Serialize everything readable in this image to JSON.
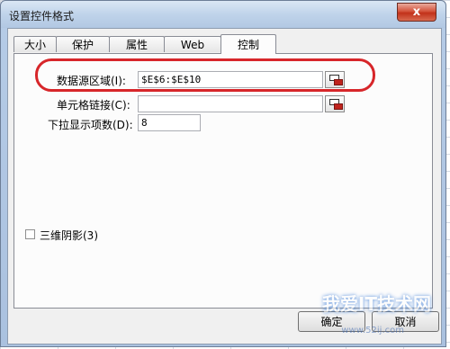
{
  "dialog": {
    "title": "设置控件格式",
    "close_label": "x"
  },
  "tabs": [
    {
      "label": "大小",
      "active": false
    },
    {
      "label": "保护",
      "active": false
    },
    {
      "label": "属性",
      "active": false
    },
    {
      "label": "Web",
      "active": false
    },
    {
      "label": "控制",
      "active": true
    }
  ],
  "control": {
    "input_range": {
      "label": "数据源区域(I):",
      "value": "$E$6:$E$10"
    },
    "cell_link": {
      "label": "单元格链接(C):",
      "value": ""
    },
    "drop_lines": {
      "label": "下拉显示项数(D):",
      "value": "8"
    },
    "shading": {
      "label": "三维阴影(3)",
      "checked": false
    }
  },
  "footer": {
    "ok_label": "确定",
    "cancel_label": "取消"
  },
  "watermark": {
    "logo": "我爱IT技术网",
    "url": "www.52ij.com"
  },
  "colors": {
    "highlight": "#d7262a",
    "close_button": "#c2311a"
  }
}
